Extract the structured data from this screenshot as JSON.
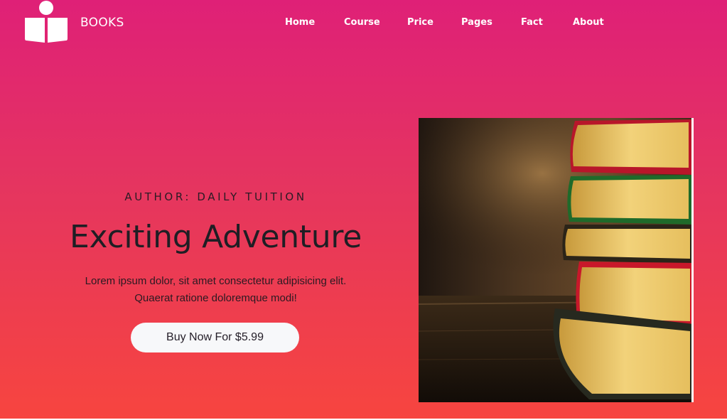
{
  "header": {
    "brand": "BOOKS",
    "logo_icon": "open-book-reader-icon",
    "nav": [
      "Home",
      "Course",
      "Price",
      "Pages",
      "Fact",
      "About"
    ]
  },
  "hero": {
    "author": "AUTHOR: DAILY TUITION",
    "title": "Exciting Adventure",
    "description_line1": "Lorem ipsum dolor, sit amet consectetur adipisicing elit.",
    "description_line2": "Quaerat ratione doloremque modi!",
    "cta_label": "Buy Now For $5.99",
    "image": "stack-of-books-photo"
  },
  "colors": {
    "gradient_top": "#df2077",
    "gradient_bottom": "#f7453f",
    "text_dark": "#1f1e24",
    "button_bg": "#f7f8fa"
  }
}
